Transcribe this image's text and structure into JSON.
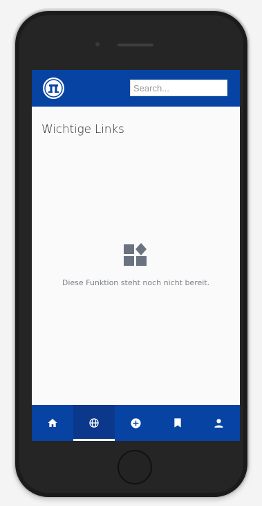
{
  "app": {
    "logo_icon": "company-logo-icon"
  },
  "header": {
    "search_placeholder": "Search..."
  },
  "main": {
    "title": "Wichtige Links",
    "empty_state": {
      "icon": "widgets-icon",
      "message": "Diese Funktion steht noch nicht bereit."
    }
  },
  "bottom_nav": {
    "active_index": 1,
    "items": [
      {
        "icon": "home-icon"
      },
      {
        "icon": "globe-icon"
      },
      {
        "icon": "add-circle-icon"
      },
      {
        "icon": "bookmark-icon"
      },
      {
        "icon": "person-icon"
      }
    ]
  },
  "colors": {
    "brand": "#0743a2",
    "background": "#fafafa",
    "muted_text": "#7a7f87",
    "icon_gray": "#6b7280"
  }
}
